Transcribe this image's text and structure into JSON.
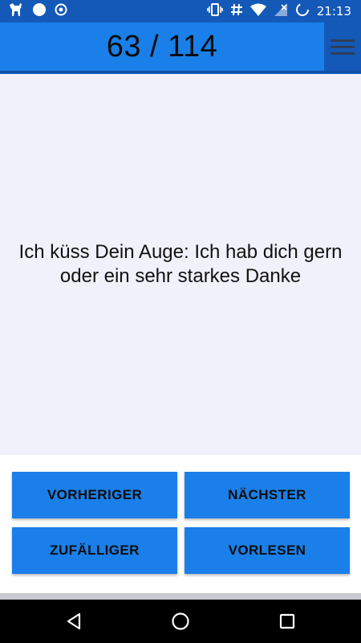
{
  "status_bar": {
    "time": "21:13",
    "left_icons": [
      "dog-icon",
      "circle-icon",
      "target-icon"
    ],
    "right_icons": [
      "vibrate-icon",
      "hash-icon",
      "wifi-icon",
      "signal-icon",
      "battery-icon"
    ]
  },
  "app_bar": {
    "counter": "63 / 114",
    "menu_icon": "hamburger-menu-icon"
  },
  "content": {
    "phrase": "Ich küss Dein Auge: Ich hab dich gern oder ein sehr starkes Danke"
  },
  "buttons": {
    "previous": "VORHERIGER",
    "next": "NÄCHSTER",
    "random": "ZUFÄLLIGER",
    "read_aloud": "VORLESEN"
  },
  "nav_bar": {
    "icons": [
      "back-icon",
      "home-icon",
      "recents-icon"
    ]
  },
  "colors": {
    "primary": "#1a7fe8",
    "primary_dark": "#1459b8",
    "content_bg": "#f1f1fb"
  }
}
